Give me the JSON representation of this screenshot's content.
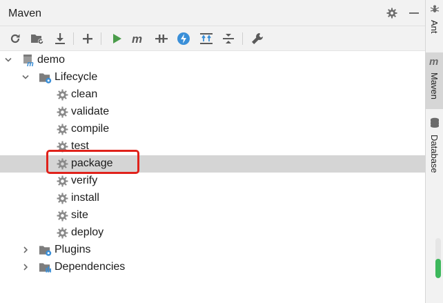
{
  "header": {
    "title": "Maven"
  },
  "toolbar": {
    "icons": [
      "reload-icon",
      "generate-sources-icon",
      "download-icon",
      "add-icon",
      "run-icon",
      "maven-goal-icon",
      "toggle-offline-icon",
      "skip-tests-icon",
      "show-dependencies-icon",
      "collapse-all-icon",
      "settings-wrench-icon"
    ]
  },
  "tree": {
    "root": "demo",
    "lifecycle": "Lifecycle",
    "goals": [
      "clean",
      "validate",
      "compile",
      "test",
      "package",
      "verify",
      "install",
      "site",
      "deploy"
    ],
    "selected_goal": "package",
    "plugins": "Plugins",
    "dependencies": "Dependencies"
  },
  "side_tabs": [
    {
      "label": "Ant",
      "active": false
    },
    {
      "label": "Maven",
      "active": true
    },
    {
      "label": "Database",
      "active": false
    }
  ],
  "scroll_indicator": {
    "fill_fraction": 0.48,
    "color": "#3db85c"
  },
  "colors": {
    "highlight": "#e0221b",
    "selection": "#d5d5d5",
    "run": "#4a9c4a",
    "bolt": "#3a8fd8"
  }
}
